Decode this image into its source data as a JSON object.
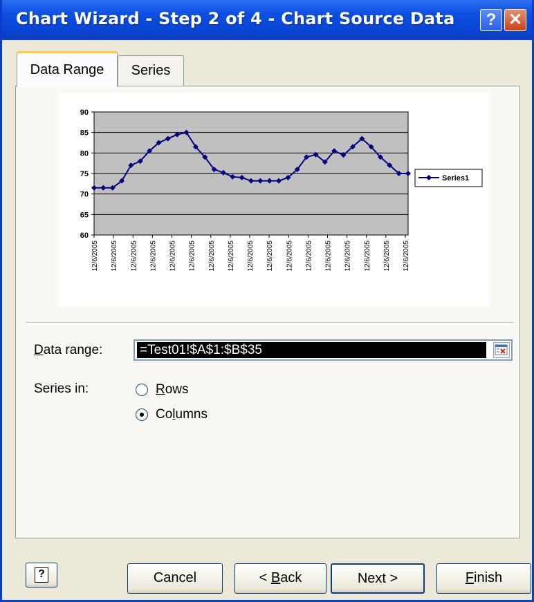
{
  "window": {
    "title": "Chart Wizard - Step 2 of 4 - Chart Source Data",
    "title_buttons": {
      "help": "?",
      "close": "✕"
    }
  },
  "tabs": [
    {
      "label": "Data Range",
      "active": true
    },
    {
      "label": "Series",
      "active": false
    }
  ],
  "chart_data": {
    "type": "line",
    "y_ticks": [
      "90",
      "85",
      "80",
      "75",
      "70",
      "65",
      "60"
    ],
    "ylim": [
      60,
      90
    ],
    "x_tick_labels": [
      "12/6/2005",
      "12/6/2005",
      "12/6/2005",
      "12/6/2005",
      "12/6/2005",
      "12/6/2005",
      "12/6/2005",
      "12/6/2005",
      "12/6/2005",
      "12/6/2005",
      "12/6/2005",
      "12/6/2005",
      "12/6/2005",
      "12/6/2005",
      "12/6/2005",
      "12/6/2005",
      "12/6/2005"
    ],
    "grid": true,
    "plot_background": "#c0c0c0",
    "line_color": "#000080",
    "legend": {
      "position": "right"
    },
    "series": [
      {
        "name": "Series1",
        "values": [
          71.5,
          71.5,
          71.5,
          73.2,
          77,
          78,
          80.5,
          82.5,
          83.5,
          84.5,
          85,
          81.5,
          79,
          76,
          75.2,
          74.2,
          74,
          73.2,
          73.2,
          73.2,
          73.2,
          74,
          76,
          79,
          79.6,
          77.8,
          80.5,
          79.5,
          81.5,
          83.5,
          81.5,
          79,
          77,
          75,
          75
        ]
      }
    ]
  },
  "form": {
    "data_range_label": "Data range:",
    "data_range_accel": "D",
    "data_range_rest": "ata range:",
    "data_range_value": "=Test01!$A$1:$B$35",
    "series_in_label": "Series in:",
    "options": [
      {
        "accel": "R",
        "rest": "ows",
        "selected": false
      },
      {
        "pre": "Co",
        "accel": "l",
        "rest": "umns",
        "selected": true
      }
    ]
  },
  "buttons": {
    "help": "?",
    "cancel": "Cancel",
    "back_pre": "< ",
    "back_accel": "B",
    "back_rest": "ack",
    "next": "Next >",
    "finish_accel": "F",
    "finish_rest": "inish"
  },
  "colors": {
    "title_bar": "#0a4fe0",
    "dialog_background": "#ece9d8",
    "close_button": "#d0502a"
  }
}
